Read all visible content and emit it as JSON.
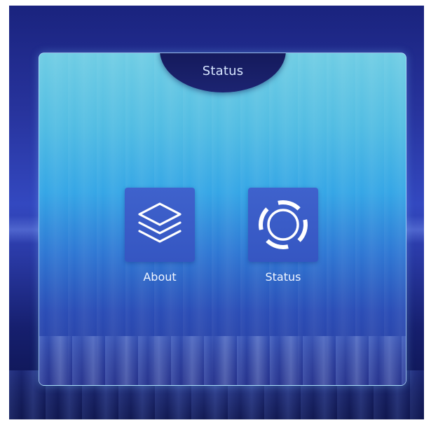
{
  "header": {
    "title": "Status"
  },
  "apps": [
    {
      "label": "About",
      "icon": "layers-icon"
    },
    {
      "label": "Status",
      "icon": "ring-icon"
    }
  ],
  "colors": {
    "background_top": "#1a237e",
    "panel_top": "#6fcde4",
    "panel_bottom": "#283a9a",
    "tab": "#14195a",
    "tile": "#3f62cc",
    "text": "#ffffff"
  }
}
